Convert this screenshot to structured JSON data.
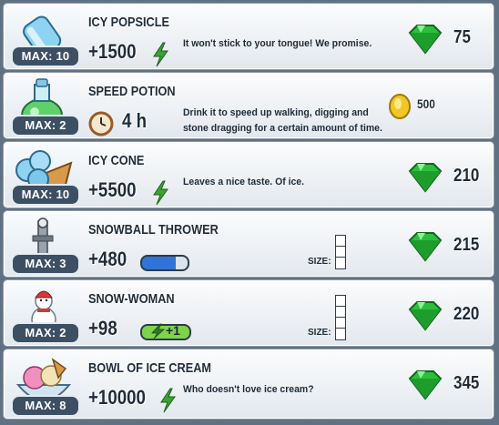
{
  "items": [
    {
      "name": "ICY POPSICLE",
      "max": "MAX: 10",
      "stat": "+1500",
      "stat_type": "energy",
      "desc": "It won't stick to your tongue! We promise.",
      "price": "75",
      "currency": "gem-icon",
      "icon": "popsicle-icon"
    },
    {
      "name": "SPEED POTION",
      "max": "MAX: 2",
      "stat": "4 h",
      "stat_type": "time",
      "desc": "Drink it to speed up walking, digging and stone dragging for a certain amount of time.",
      "price": "500",
      "currency": "coin-icon",
      "icon": "potion-icon"
    },
    {
      "name": "ICY CONE",
      "max": "MAX: 10",
      "stat": "+5500",
      "stat_type": "energy",
      "desc": "Leaves a nice taste. Of ice.",
      "price": "210",
      "currency": "gem-icon",
      "icon": "icy-cone-icon"
    },
    {
      "name": "SNOWBALL THROWER",
      "max": "MAX: 3",
      "stat": "+480",
      "stat_type": "bar",
      "size_label": "SIZE:",
      "desc": "",
      "price": "215",
      "currency": "gem-icon",
      "icon": "snowball-thrower-icon"
    },
    {
      "name": "SNOW-WOMAN",
      "max": "MAX: 2",
      "stat": "+98",
      "stat_type": "energy-badge",
      "badge": "+1",
      "size_label": "SIZE:",
      "desc": "",
      "price": "220",
      "currency": "gem-icon",
      "icon": "snow-woman-icon"
    },
    {
      "name": "BOWL OF ICE CREAM",
      "max": "MAX: 8",
      "stat": "+10000",
      "stat_type": "energy",
      "desc": "Who doesn't love ice cream?",
      "price": "345",
      "currency": "gem-icon",
      "icon": "ice-cream-bowl-icon"
    }
  ],
  "colors": {
    "gem": "#29b83a",
    "energy": "#3aa335",
    "coin": "#f2c624",
    "bar_blue": "#2f74d6",
    "bar_green": "#7fd24a"
  }
}
